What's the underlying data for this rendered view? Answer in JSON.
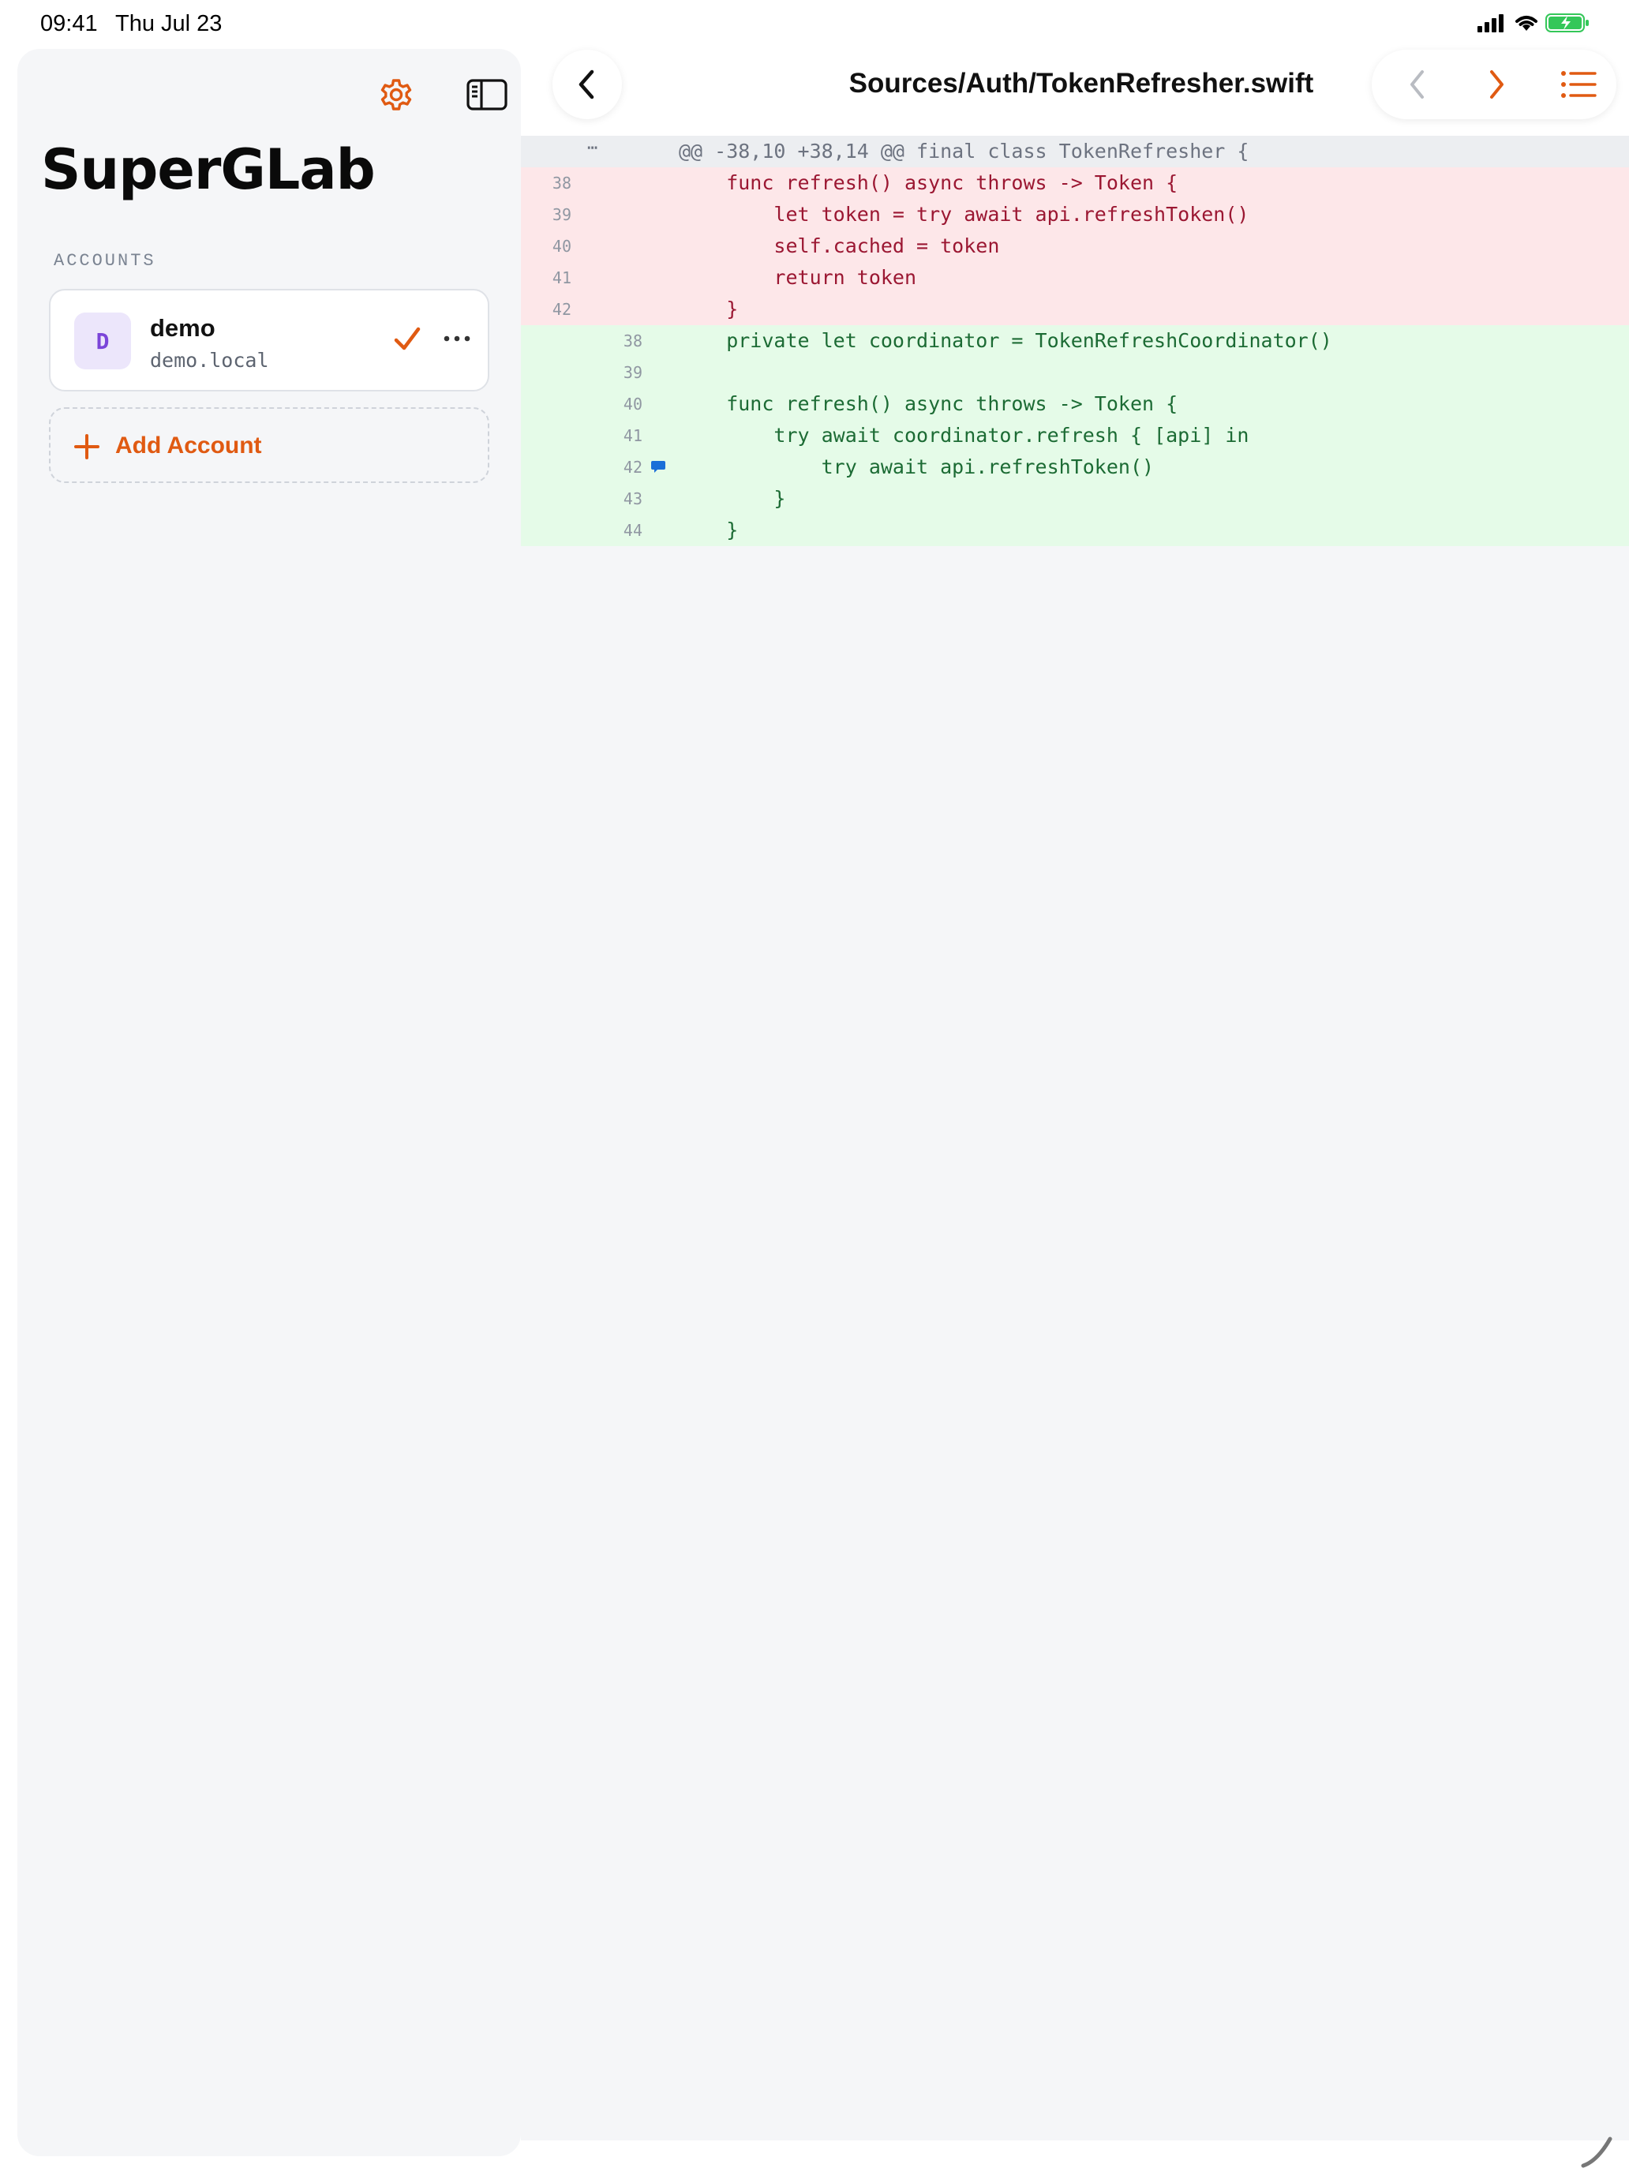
{
  "status": {
    "time": "09:41",
    "date": "Thu Jul 23"
  },
  "sidebar": {
    "app_title": "SuperGLab",
    "section_label": "ACCOUNTS",
    "account": {
      "initial": "D",
      "name": "demo",
      "host": "demo.local",
      "selected": true
    },
    "add_account_label": "Add Account"
  },
  "header": {
    "file_path": "Sources/Auth/TokenRefresher.swift"
  },
  "diff": {
    "hunk_header": "@@ -38,10 +38,14 @@ final class TokenRefresher {",
    "hunk_dots": "⋯",
    "rows": [
      {
        "type": "del",
        "old": "38",
        "new": "",
        "code": "    func refresh() async throws -> Token {"
      },
      {
        "type": "del",
        "old": "39",
        "new": "",
        "code": "        let token = try await api.refreshToken()"
      },
      {
        "type": "del",
        "old": "40",
        "new": "",
        "code": "        self.cached = token"
      },
      {
        "type": "del",
        "old": "41",
        "new": "",
        "code": "        return token"
      },
      {
        "type": "del",
        "old": "42",
        "new": "",
        "code": "    }"
      },
      {
        "type": "add",
        "old": "",
        "new": "38",
        "code": "    private let coordinator = TokenRefreshCoordinator()"
      },
      {
        "type": "add",
        "old": "",
        "new": "39",
        "code": ""
      },
      {
        "type": "add",
        "old": "",
        "new": "40",
        "code": "    func refresh() async throws -> Token {"
      },
      {
        "type": "add",
        "old": "",
        "new": "41",
        "code": "        try await coordinator.refresh { [api] in"
      },
      {
        "type": "add",
        "old": "",
        "new": "42",
        "code": "            try await api.refreshToken()",
        "has_comment": true
      },
      {
        "type": "add",
        "old": "",
        "new": "43",
        "code": "        }"
      },
      {
        "type": "add",
        "old": "",
        "new": "44",
        "code": "    }"
      }
    ]
  },
  "colors": {
    "accent": "#e05a12",
    "deleted_bg": "#fde7e9",
    "added_bg": "#e5fbe8",
    "comment_marker": "#1a6fd8"
  },
  "icons": {
    "settings": "gear-icon",
    "sidebar_toggle": "sidebar-toggle-icon",
    "back": "chevron-left-icon",
    "prev_file": "chevron-left-icon",
    "next_file": "chevron-right-icon",
    "file_list": "list-icon",
    "account_selected": "checkmark-icon",
    "account_menu": "ellipsis-icon",
    "add": "plus-icon",
    "comment": "comment-bubble-icon"
  }
}
